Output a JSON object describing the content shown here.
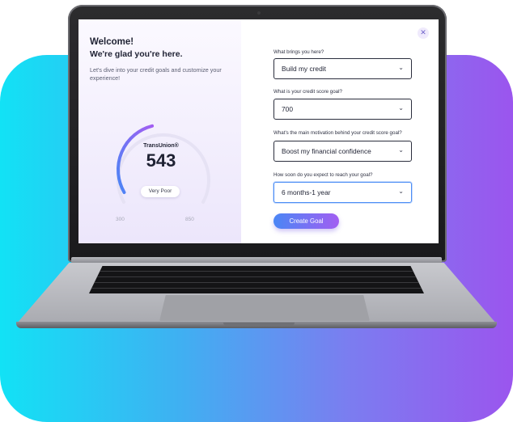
{
  "welcome": {
    "title": "Welcome!",
    "subtitle": "We're glad you're here.",
    "intro": "Let's dive into your credit goals and customize your experience!"
  },
  "score_card": {
    "bureau": "TransUnion®",
    "score": "543",
    "rating": "Very Poor",
    "min": "300",
    "max": "850",
    "score_fraction": 0.44
  },
  "form": {
    "close_icon": "close-icon",
    "questions": [
      {
        "label": "What brings you here?",
        "value": "Build my credit"
      },
      {
        "label": "What is your credit score goal?",
        "value": "700"
      },
      {
        "label": "What's the main motivation behind your credit score goal?",
        "value": "Boost my financial confidence"
      },
      {
        "label": "How soon do you expect to reach your goal?",
        "value": "6 months-1 year"
      }
    ],
    "submit_label": "Create Goal"
  },
  "colors": {
    "background_gradient": [
      "#12e2f5",
      "#9b55ee"
    ],
    "button_gradient": [
      "#4a86f5",
      "#a25ef2"
    ],
    "gauge_gradient": [
      "#4a86f5",
      "#a25ef2"
    ],
    "focus_border": "#4b8df5"
  }
}
